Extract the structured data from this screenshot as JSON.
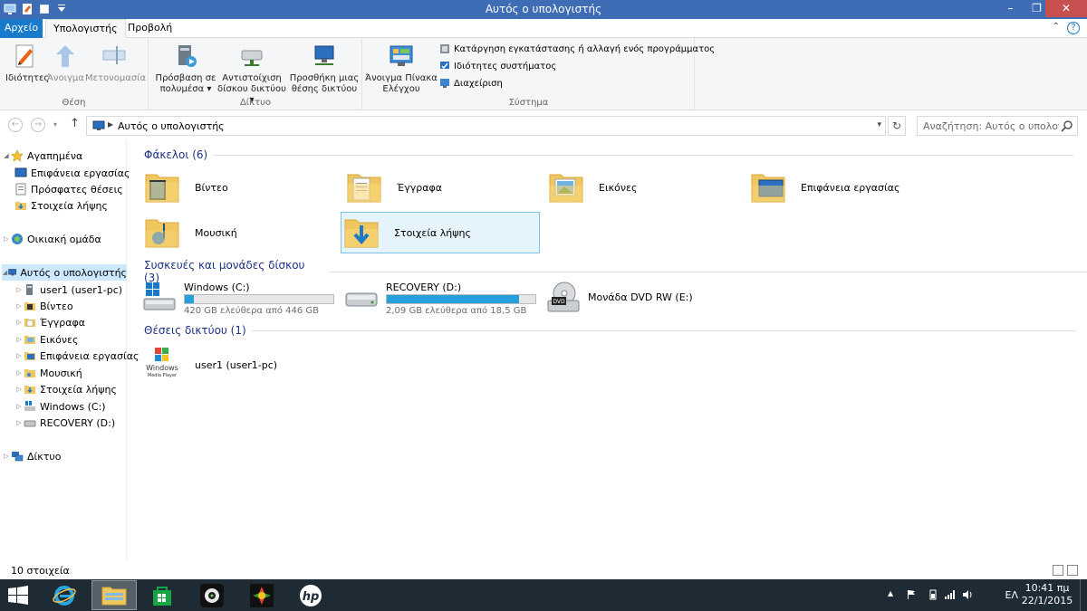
{
  "window": {
    "title": "Αυτός ο υπολογιστής"
  },
  "ribbon": {
    "tabs": [
      {
        "label": "Αρχείο"
      },
      {
        "label": "Υπολογιστής"
      },
      {
        "label": "Προβολή"
      }
    ],
    "groups": {
      "location": {
        "label": "Θέση",
        "buttons": [
          "Ιδιότητες",
          "Άνοιγμα",
          "Μετονομασία"
        ]
      },
      "network": {
        "label": "Δίκτυο",
        "buttons": [
          {
            "line1": "Πρόσβαση σε",
            "line2": "πολυμέσα"
          },
          {
            "line1": "Αντιστοίχιση",
            "line2": "δίσκου δικτύου"
          },
          {
            "line1": "Προσθήκη μιας",
            "line2": "θέσης δικτύου"
          }
        ]
      },
      "system": {
        "label": "Σύστημα",
        "control_panel": {
          "line1": "Άνοιγμα Πίνακα",
          "line2": "Ελέγχου"
        },
        "items": [
          "Κατάργηση εγκατάστασης ή αλλαγή ενός προγράμματος",
          "Ιδιότητες συστήματος",
          "Διαχείριση"
        ]
      }
    }
  },
  "address": {
    "path": "Αυτός ο υπολογιστής",
    "search_placeholder": "Αναζήτηση: Αυτός ο υπολογισ..."
  },
  "nav": {
    "items": [
      {
        "label": "Αγαπημένα"
      },
      {
        "label": "Επιφάνεια εργασίας"
      },
      {
        "label": "Πρόσφατες θέσεις"
      },
      {
        "label": "Στοιχεία λήψης"
      },
      {
        "label": "Οικιακή ομάδα"
      },
      {
        "label": "Αυτός ο υπολογιστής"
      },
      {
        "label": "user1 (user1-pc)"
      },
      {
        "label": "Βίντεο"
      },
      {
        "label": "Έγγραφα"
      },
      {
        "label": "Εικόνες"
      },
      {
        "label": "Επιφάνεια εργασίας"
      },
      {
        "label": "Μουσική"
      },
      {
        "label": "Στοιχεία λήψης"
      },
      {
        "label": "Windows (C:)"
      },
      {
        "label": "RECOVERY (D:)"
      },
      {
        "label": "Δίκτυο"
      }
    ]
  },
  "content": {
    "folders_header": "Φάκελοι (6)",
    "folders": [
      {
        "label": "Βίντεο"
      },
      {
        "label": "Έγγραφα"
      },
      {
        "label": "Εικόνες"
      },
      {
        "label": "Επιφάνεια εργασίας"
      },
      {
        "label": "Μουσική"
      },
      {
        "label": "Στοιχεία λήψης"
      }
    ],
    "drives_header": "Συσκευές και μονάδες δίσκου (3)",
    "drives": [
      {
        "name": "Windows (C:)",
        "free": "420 GB ελεύθερα από 446 GB",
        "used_fraction": 0.06
      },
      {
        "name": "RECOVERY (D:)",
        "free": "2,09 GB ελεύθερα από 18,5 GB",
        "used_fraction": 0.89
      },
      {
        "name": "Μονάδα DVD RW (E:)"
      }
    ],
    "network_header": "Θέσεις δικτύου (1)",
    "network": [
      {
        "label": "user1 (user1-pc)",
        "icon_text": "Windows",
        "icon_sub": "Media Player"
      }
    ]
  },
  "status": {
    "count": "10 στοιχεία"
  },
  "taskbar": {
    "lang": "ΕΛ",
    "time": "10:41 πμ",
    "date": "22/1/2015"
  }
}
